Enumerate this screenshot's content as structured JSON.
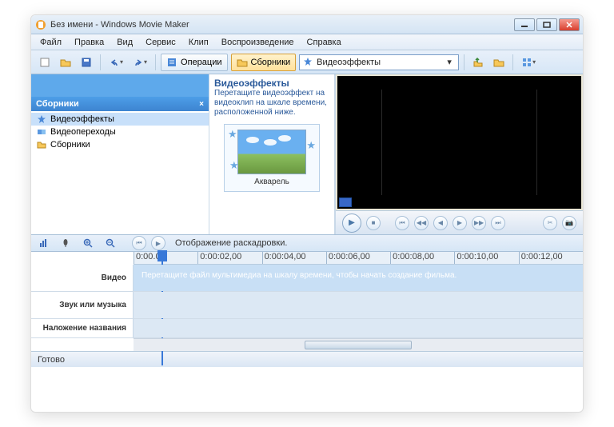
{
  "window": {
    "title": "Без имени - Windows Movie Maker"
  },
  "menu": [
    "Файл",
    "Правка",
    "Вид",
    "Сервис",
    "Клип",
    "Воспроизведение",
    "Справка"
  ],
  "toolbar": {
    "operations_label": "Операции",
    "collections_label": "Сборники",
    "combo_value": "Видеоэффекты"
  },
  "sidebar": {
    "title": "Сборники",
    "items": [
      {
        "label": "Видеоэффекты",
        "icon": "star"
      },
      {
        "label": "Видеопереходы",
        "icon": "transition"
      },
      {
        "label": "Сборники",
        "icon": "folder"
      }
    ]
  },
  "midpane": {
    "heading": "Видеоэффекты",
    "instruction": "Перетащите видеоэффект на видеоклип на шкале времени, расположенной ниже.",
    "effect_name": "Акварель"
  },
  "timeline": {
    "storyboard_toggle": "Отображение раскадровки.",
    "ticks": [
      "0:00.00",
      "0:00:02,00",
      "0:00:04,00",
      "0:00:06,00",
      "0:00:08,00",
      "0:00:10,00",
      "0:00:12,00"
    ],
    "tracks": {
      "video": "Видео",
      "audio": "Звук или музыка",
      "title": "Наложение названия"
    },
    "video_hint": "Перетащите файл мультимедиа на шкалу времени, чтобы начать создание фильма."
  },
  "status": "Готово"
}
